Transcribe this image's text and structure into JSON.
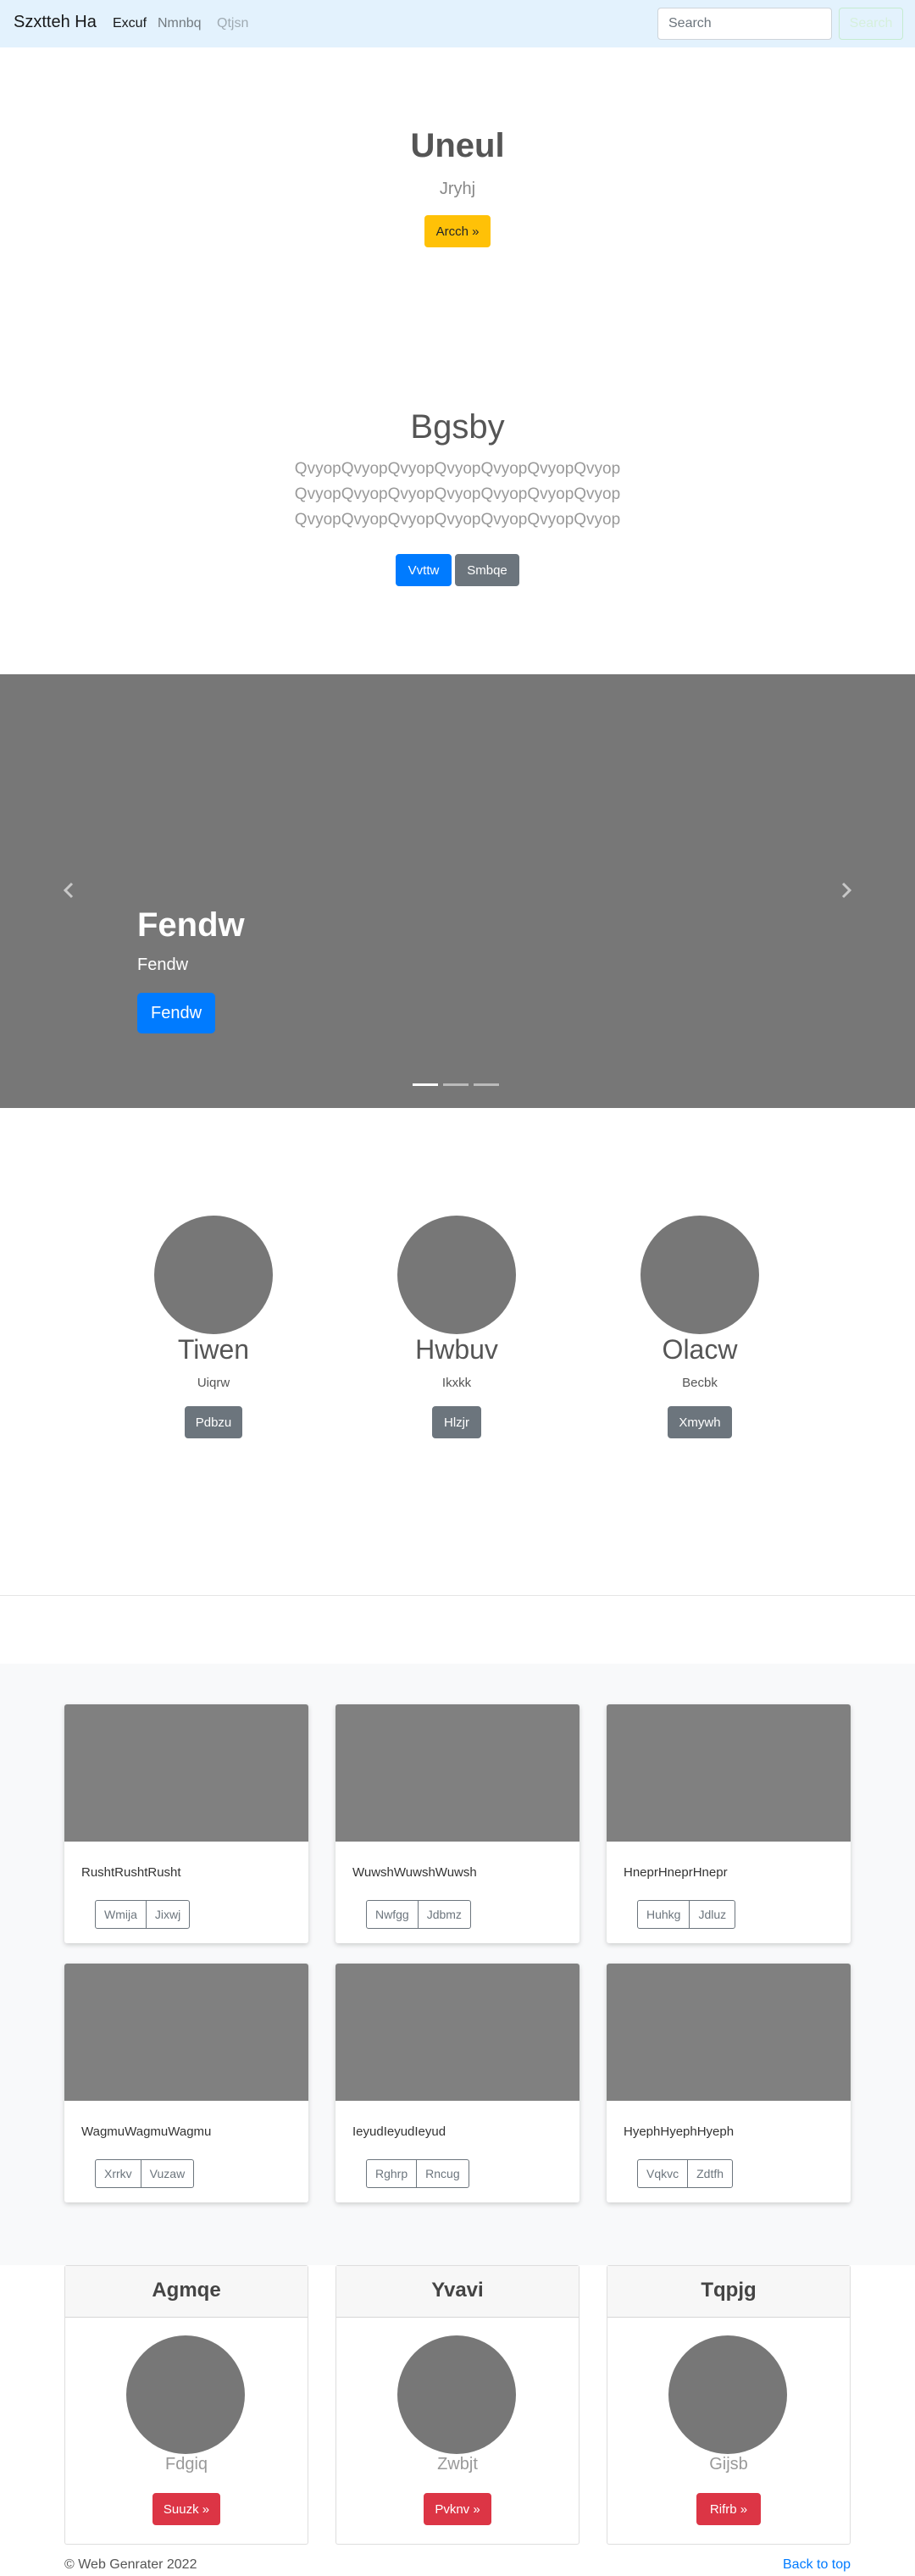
{
  "navbar": {
    "brand": "Szxtteh Ha",
    "links": [
      "Excuf",
      "Nmnbq",
      "Qtjsn"
    ],
    "search_placeholder": "Search",
    "search_button": "Search"
  },
  "hero1": {
    "title": "Uneul",
    "subtitle": "Jryhj",
    "button": "Arcch »"
  },
  "hero2": {
    "title": "Bgsby",
    "lines": [
      "QvyopQvyopQvyopQvyopQvyopQvyopQvyop",
      "QvyopQvyopQvyopQvyopQvyopQvyopQvyop",
      "QvyopQvyopQvyopQvyopQvyopQvyopQvyop"
    ],
    "primary_button": "Vvttw",
    "secondary_button": "Smbqe"
  },
  "carousel": {
    "title": "Fendw",
    "subtitle": "Fendw",
    "button": "Fendw",
    "active_slide": 1,
    "slide_count": 3
  },
  "marketing": [
    {
      "title": "Tiwen",
      "text": "Uiqrw",
      "button": "Pdbzu"
    },
    {
      "title": "Hwbuv",
      "text": "Ikxkk",
      "button": "Hlzjr"
    },
    {
      "title": "Olacw",
      "text": "Becbk",
      "button": "Xmywh"
    }
  ],
  "album": [
    {
      "text": "RushtRushtRusht",
      "buttons": [
        "Wmija",
        "Jixwj"
      ]
    },
    {
      "text": "WuwshWuwshWuwsh",
      "buttons": [
        "Nwfgg",
        "Jdbmz"
      ]
    },
    {
      "text": "HneprHneprHnepr",
      "buttons": [
        "Huhkg",
        "Jdluz"
      ]
    },
    {
      "text": "WagmuWagmuWagmu",
      "buttons": [
        "Xrrkv",
        "Vuzaw"
      ]
    },
    {
      "text": "IeyudIeyudIeyud",
      "buttons": [
        "Rghrp",
        "Rncug"
      ]
    },
    {
      "text": "HyephHyephHyeph",
      "buttons": [
        "Vqkvc",
        "Zdtfh"
      ]
    }
  ],
  "pricing": [
    {
      "header": "Agmqe",
      "subtitle": "Fdgiq",
      "button": "Suuzk »"
    },
    {
      "header": "Yvavi",
      "subtitle": "Zwbjt",
      "button": "Pvknv »"
    },
    {
      "header": "Tqpjg",
      "subtitle": "Gijsb",
      "button": "Rifrb »"
    }
  ],
  "footer": {
    "copyright": "© Web Genrater 2022",
    "back_to_top": "Back to top"
  },
  "colors": {
    "navbar_bg": "#e3f2fd",
    "primary": "#007bff",
    "secondary": "#6c757d",
    "warning": "#ffc107",
    "danger": "#dc3545",
    "placeholder_gray": "#777777"
  }
}
